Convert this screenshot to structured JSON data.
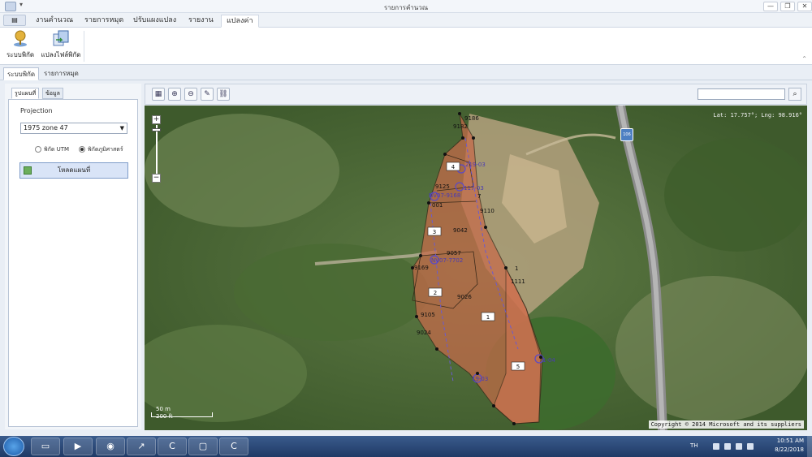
{
  "window": {
    "title": "รายการคำนวณ",
    "quick_access": "▾",
    "minimize": "—",
    "restore": "❐",
    "close": "✕"
  },
  "ribbon_tabs": [
    {
      "label": "งานคำนวณ"
    },
    {
      "label": "รายการหมุด"
    },
    {
      "label": "ปรับแผงแปลง"
    },
    {
      "label": "รายงาน"
    },
    {
      "label": "แปลงค่า",
      "active": true
    }
  ],
  "ribbon": {
    "buttons": [
      {
        "label": "ระบบพิกัด",
        "icon": "pin-icon"
      },
      {
        "label": "แปลงไฟล์พิกัด",
        "icon": "convert-file-icon"
      }
    ]
  },
  "doc_tabs": [
    {
      "label": "ระบบพิกัด",
      "active": true
    },
    {
      "label": "รายการหมุด"
    }
  ],
  "left_panel": {
    "tabs": [
      {
        "label": "รูปแผนที่",
        "active": true
      },
      {
        "label": "ข้อมูล"
      }
    ],
    "projection_label": "Projection",
    "projection_value": "1975 zone 47",
    "radio_utm": "พิกัด UTM",
    "radio_geo": "พิกัดภูมิศาสตร์",
    "radio_selected": "geo",
    "load_button": "โหลดแผนที่"
  },
  "map": {
    "coord_readout": "Lat: 17.757°; Lng: 98.916°",
    "copyright": "Copyright © 2014 Microsoft and its suppliers",
    "scale_top": "50 m",
    "scale_bottom": "200 ft",
    "road_marker": "106",
    "plot_labels": [
      "1",
      "2",
      "3",
      "4",
      "5"
    ],
    "point_numbers": [
      "9182",
      "9186",
      "9125",
      "9110",
      "9042",
      "9057",
      "9169",
      "9026",
      "9105",
      "9024",
      "1111",
      "7",
      "001",
      "1"
    ],
    "control_ids": [
      "219-03",
      "117-03",
      "NV07-9168",
      "NV07-7702",
      "19-03",
      "1-04"
    ]
  },
  "taskbar": {
    "language": "TH",
    "time": "10:51 AM",
    "date": "8/22/2018"
  }
}
